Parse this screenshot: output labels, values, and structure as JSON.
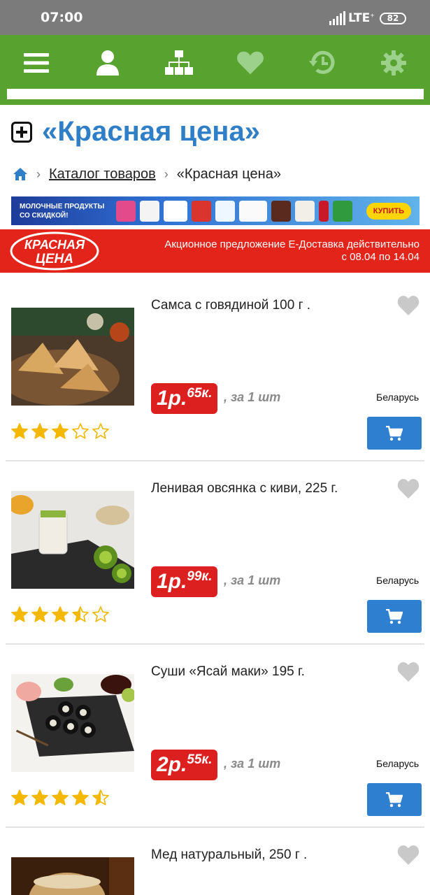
{
  "status_bar": {
    "time": "07:00",
    "network": "LTE",
    "network_sub": "+",
    "battery": "82"
  },
  "nav": {
    "icons": [
      "menu-icon",
      "user-icon",
      "sitemap-icon",
      "heart-icon",
      "history-icon",
      "gear-icon"
    ],
    "color": "#58a22f"
  },
  "page": {
    "title": "«Красная цена»"
  },
  "breadcrumb": {
    "catalog": "Каталог товаров",
    "current": "«Красная цена»"
  },
  "promo": {
    "line1": "МОЛОЧНЫЕ ПРОДУКТЫ",
    "line2": "СО СКИДКОЙ!",
    "button": "КУПИТЬ"
  },
  "banner": {
    "logo_line1": "КРАСНАЯ",
    "logo_line2": "ЦЕНА",
    "offer_line1": "Акционное предложение Е-Доставка действительно",
    "offer_line2": "с 08.04 по 14.04"
  },
  "products": [
    {
      "name": "Самса с говядиной 100 г .",
      "price_rub": "1р.",
      "price_kop": "65к.",
      "unit": ", за 1 шт",
      "country": "Беларусь",
      "rating": 3
    },
    {
      "name": "Ленивая овсянка с киви, 225 г.",
      "price_rub": "1р.",
      "price_kop": "99к.",
      "unit": ", за 1 шт",
      "country": "Беларусь",
      "rating": 3.5
    },
    {
      "name": "Суши «Ясай маки» 195 г.",
      "price_rub": "2р.",
      "price_kop": "55к.",
      "unit": ", за 1 шт",
      "country": "Беларусь",
      "rating": 4.5
    },
    {
      "name": "Мед натуральный, 250 г .",
      "price_rub": "",
      "price_kop": "",
      "unit": "",
      "country": "",
      "rating": null
    }
  ],
  "colors": {
    "accent_blue": "#2f7fc8",
    "price_red": "#dc1f1f",
    "star": "#f5b800"
  }
}
